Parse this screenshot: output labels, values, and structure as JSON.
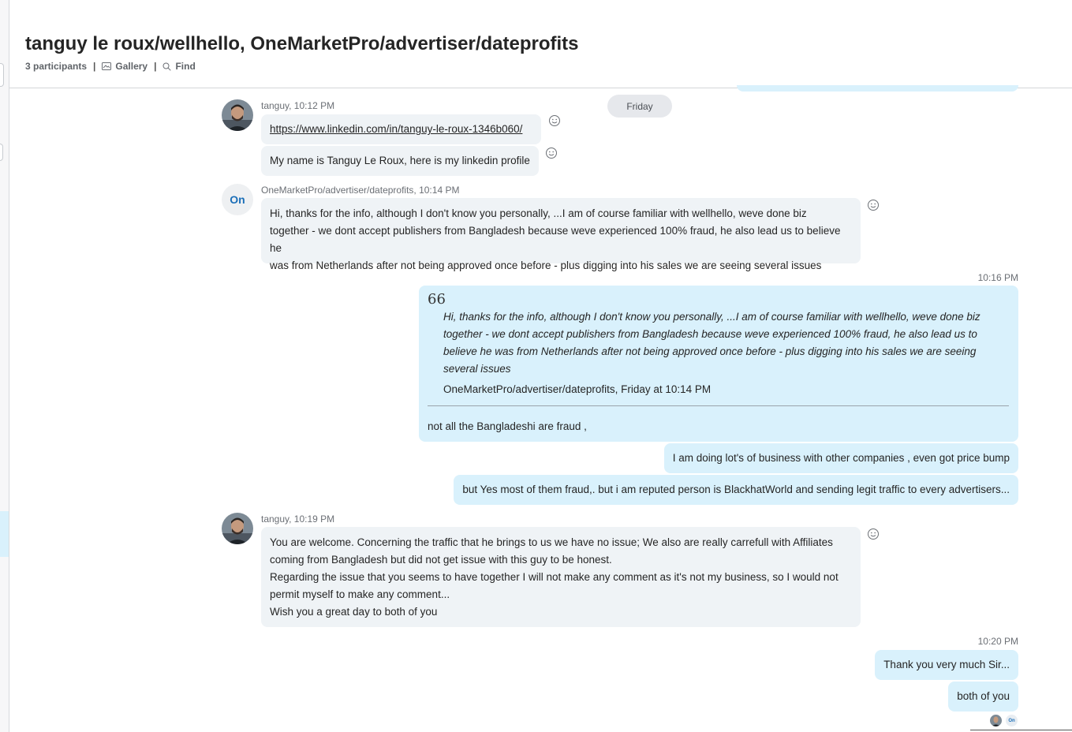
{
  "header": {
    "title": "tanguy le roux/wellhello, OneMarketPro/advertiser/dateprofits",
    "participants": "3 participants",
    "gallery_label": "Gallery",
    "find_label": "Find",
    "separator": "|"
  },
  "day_divider": "Friday",
  "avatar_on_initials": "On",
  "messages": {
    "m1": {
      "sender": "tanguy, 10:12 PM",
      "link": "https://www.linkedin.com/in/tanguy-le-roux-1346b060/",
      "text2": "My name is Tanguy Le Roux, here is my linkedin profile"
    },
    "m2": {
      "sender": "OneMarketPro/advertiser/dateprofits, 10:14 PM",
      "lines": [
        "Hi, thanks for the info, although I don't know you personally, ...I am of course familiar with wellhello, weve done biz",
        "together - we dont accept publishers from Bangladesh because weve experienced 100% fraud, he also lead us to believe he",
        "was from Netherlands after not being approved once before - plus digging into his sales we are seeing several issues"
      ]
    },
    "m3": {
      "time": "10:16 PM",
      "quote_mark": "66",
      "quote_lines": [
        "Hi, thanks for the info, although I don't know you personally, ...I am of course familiar with wellhello, weve done biz",
        "together - we dont accept publishers from Bangladesh because weve experienced 100% fraud, he also lead us to",
        "believe he was from Netherlands after not being approved once before - plus digging into his sales we are seeing",
        "several issues"
      ],
      "quote_source": "OneMarketPro/advertiser/dateprofits, Friday at 10:14 PM",
      "reply": "not all the Bangladeshi are fraud ,",
      "followup1": "I am doing lot's of business with other companies , even got price bump",
      "followup2": "but Yes most of them fraud,. but i am reputed person is BlackhatWorld and sending legit traffic to every advertisers..."
    },
    "m4": {
      "sender": "tanguy, 10:19 PM",
      "lines": [
        "You are welcome. Concerning the traffic that he brings to us we have no issue; We also are really carrefull with Affiliates",
        "coming from Bangladesh but did not get issue with this guy to be honest.",
        "Regarding the issue that you seems to have together I will not make any comment as it's not my business, so I would not",
        "permit myself to make any comment...",
        "Wish you a great day to both of you"
      ]
    },
    "m5": {
      "time": "10:20 PM",
      "text1": "Thank you very much Sir...",
      "text2": "both of you"
    }
  },
  "read_receipt_on": "On",
  "icons": [
    "gallery-icon",
    "search-icon",
    "smiley-react-icon",
    "quote-icon"
  ],
  "colors": {
    "incoming_bubble": "#eff3f6",
    "outgoing_bubble": "#d9f1fc",
    "day_pill": "#e6e8ec",
    "avatar_on_text": "#1b6fb8"
  }
}
